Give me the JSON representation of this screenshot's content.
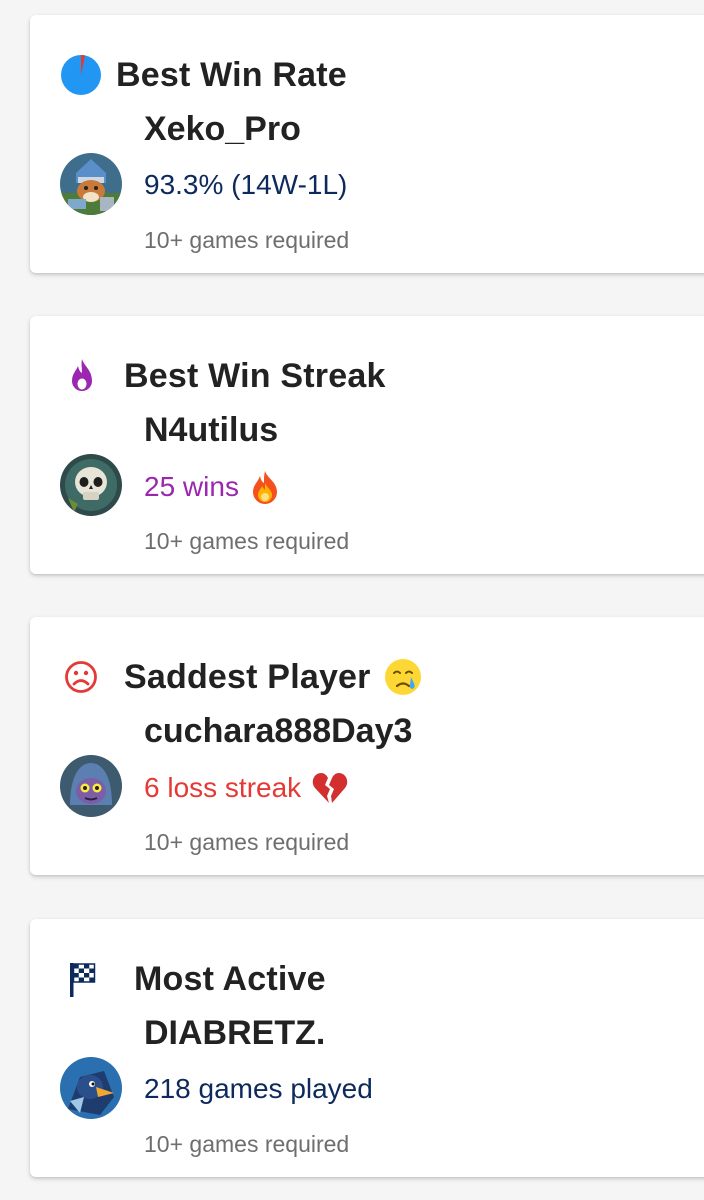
{
  "cards": [
    {
      "title": "Best Win Rate",
      "title_icon": "pie-chart-icon",
      "player": "Xeko_Pro",
      "stat": "93.3% (14W-1L)",
      "stat_color": "#0d2a5c",
      "requirement": "10+ games required",
      "avatar": "fox-knight-avatar"
    },
    {
      "title": "Best Win Streak",
      "title_icon": "flame-icon",
      "player": "N4utilus",
      "stat": "25 wins",
      "stat_emoji": "fire-emoji",
      "stat_color": "#9b27b0",
      "requirement": "10+ games required",
      "avatar": "skull-avatar"
    },
    {
      "title": "Saddest Player",
      "title_icon": "sad-face-icon",
      "title_emoji": "crying-face-emoji",
      "player": "cuchara888Day3",
      "stat": "6 loss streak",
      "stat_emoji": "broken-heart-emoji",
      "stat_color": "#e53935",
      "requirement": "10+ games required",
      "avatar": "hooded-creature-avatar"
    },
    {
      "title": "Most Active",
      "title_icon": "checkered-flag-icon",
      "player": "DIABRETZ.",
      "stat": "218 games played",
      "stat_color": "#0d2a5c",
      "requirement": "10+ games required",
      "avatar": "bird-warrior-avatar"
    }
  ],
  "colors": {
    "background": "#f5f5f5",
    "card": "#ffffff",
    "title": "#222222",
    "secondary": "#6e6e6e",
    "accent_blue": "#2196f3",
    "accent_purple": "#9b27b0",
    "accent_red": "#e53935",
    "accent_navy": "#0d2a5c"
  }
}
